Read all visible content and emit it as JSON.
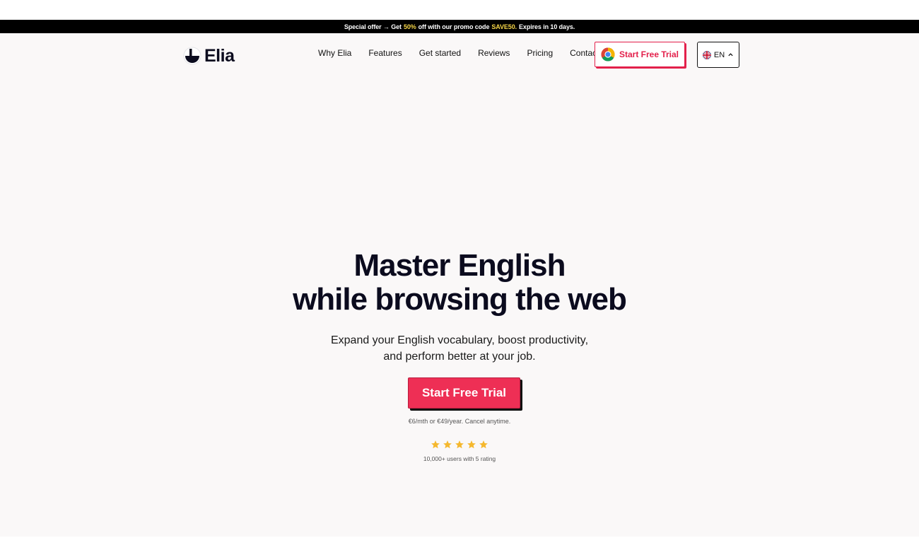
{
  "promo": {
    "prefix": "Special offer → Get",
    "discount": "50%",
    "middle": "off with our promo code",
    "code": "SAVE50.",
    "suffix": "Expires in 10 days."
  },
  "brand": {
    "name": "Elia"
  },
  "nav": {
    "items": [
      {
        "label": "Why Elia"
      },
      {
        "label": "Features"
      },
      {
        "label": "Get started"
      },
      {
        "label": "Reviews"
      },
      {
        "label": "Pricing"
      },
      {
        "label": "Contact"
      }
    ],
    "cta_label": "Start Free Trial",
    "cta_icon": "chrome-icon",
    "language": "EN",
    "language_icon": "uk-flag-icon"
  },
  "hero": {
    "title_line1": "Master English",
    "title_line2": "while browsing the web",
    "subtitle_line1": "Expand your English vocabulary, boost productivity,",
    "subtitle_line2": "and perform better at your job.",
    "cta_label": "Start Free Trial",
    "price_note": "€6/mth or €49/year. Cancel anytime.",
    "rating": {
      "stars": 5,
      "max": 5,
      "label": "10,000+ users with 5 rating"
    }
  },
  "colors": {
    "accent": "#ee2f55",
    "accent_border": "#e3204b",
    "promo_highlight": "#f5d547",
    "star": "#f5b82e",
    "page_bg": "#faf8f8"
  }
}
